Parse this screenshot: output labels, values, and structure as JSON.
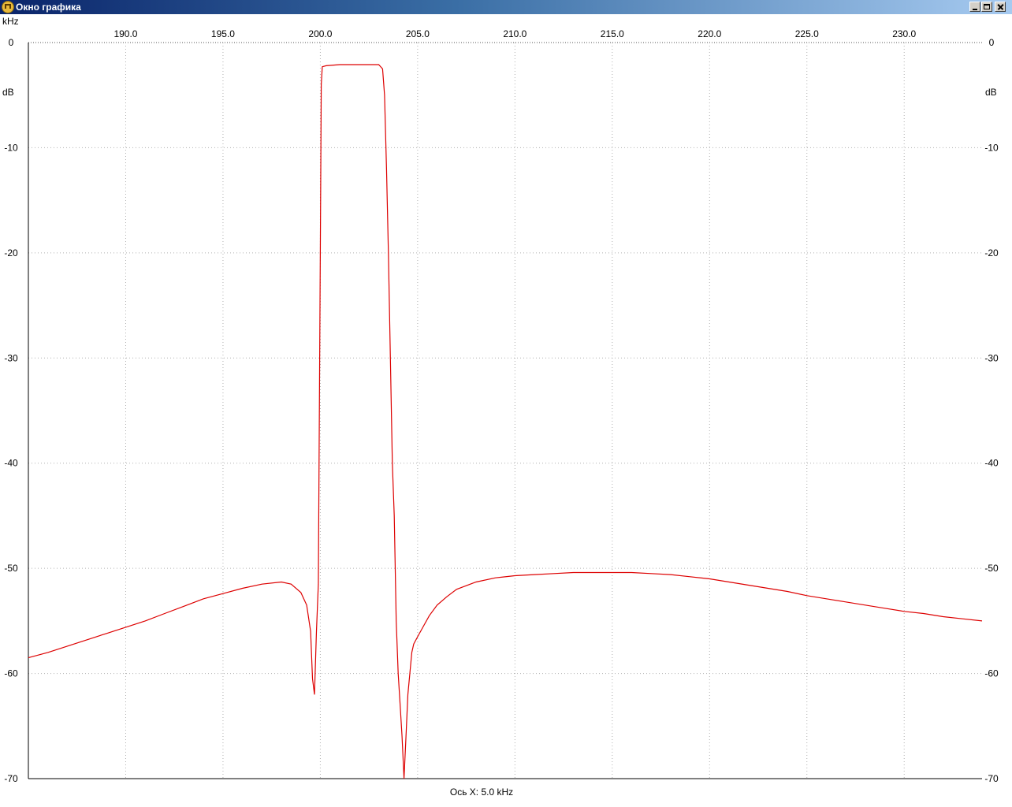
{
  "window": {
    "title": "Окно графика",
    "icon": "filter-response-icon",
    "buttons": [
      "minimize",
      "maximize",
      "close"
    ]
  },
  "chart_data": {
    "type": "line",
    "x_unit_label": "kHz",
    "y_unit_label": "dB",
    "xlim": [
      185.0,
      234.0
    ],
    "ylim": [
      -70,
      0
    ],
    "x_ticks": [
      190.0,
      195.0,
      200.0,
      205.0,
      210.0,
      215.0,
      220.0,
      225.0,
      230.0
    ],
    "x_tick_labels": [
      "190.0",
      "195.0",
      "200.0",
      "205.0",
      "210.0",
      "215.0",
      "220.0",
      "225.0",
      "230.0"
    ],
    "y_ticks": [
      0,
      -10,
      -20,
      -30,
      -40,
      -50,
      -60,
      -70
    ],
    "y_tick_labels": [
      "0",
      "-10",
      "-20",
      "-30",
      "-40",
      "-50",
      "-60",
      "-70"
    ],
    "grid": true,
    "footer": "Ось X: 5.0 kHz",
    "line_color": "#dd0000",
    "series": [
      {
        "x": [
          185.0,
          186.0,
          187.0,
          188.0,
          189.0,
          190.0,
          191.0,
          192.0,
          193.0,
          194.0,
          195.0,
          196.0,
          197.0,
          198.0,
          198.5,
          199.0,
          199.3,
          199.5,
          199.6,
          199.7,
          199.8,
          199.9,
          200.0,
          200.05,
          200.1,
          200.3,
          201.0,
          202.0,
          203.0,
          203.2,
          203.3,
          203.4,
          203.5,
          203.6,
          203.7,
          203.8,
          203.9,
          204.0,
          204.1,
          204.2,
          204.3,
          204.4,
          204.5,
          204.6,
          204.7,
          204.8,
          205.0,
          205.3,
          205.6,
          206.0,
          206.5,
          207.0,
          208.0,
          209.0,
          210.0,
          211.0,
          212.0,
          213.0,
          214.0,
          215.0,
          216.0,
          217.0,
          218.0,
          219.0,
          220.0,
          221.0,
          222.0,
          223.0,
          224.0,
          225.0,
          226.0,
          227.0,
          228.0,
          229.0,
          230.0,
          231.0,
          232.0,
          233.0,
          234.0
        ],
        "y": [
          -58.5,
          -58.0,
          -57.4,
          -56.8,
          -56.2,
          -55.6,
          -55.0,
          -54.3,
          -53.6,
          -52.9,
          -52.4,
          -51.9,
          -51.5,
          -51.3,
          -51.5,
          -52.3,
          -53.5,
          -56.0,
          -60.5,
          -62.0,
          -56.0,
          -51.5,
          -20.0,
          -4.0,
          -2.3,
          -2.2,
          -2.1,
          -2.1,
          -2.1,
          -2.5,
          -5.0,
          -12.0,
          -20.0,
          -30.0,
          -40.0,
          -45.0,
          -55.0,
          -60.0,
          -63.0,
          -66.0,
          -70.0,
          -66.0,
          -62.0,
          -60.0,
          -58.0,
          -57.2,
          -56.5,
          -55.5,
          -54.5,
          -53.5,
          -52.7,
          -52.0,
          -51.3,
          -50.9,
          -50.7,
          -50.6,
          -50.5,
          -50.4,
          -50.4,
          -50.4,
          -50.4,
          -50.5,
          -50.6,
          -50.8,
          -51.0,
          -51.3,
          -51.6,
          -51.9,
          -52.2,
          -52.6,
          -52.9,
          -53.2,
          -53.5,
          -53.8,
          -54.1,
          -54.3,
          -54.6,
          -54.8,
          -55.0
        ]
      }
    ]
  }
}
